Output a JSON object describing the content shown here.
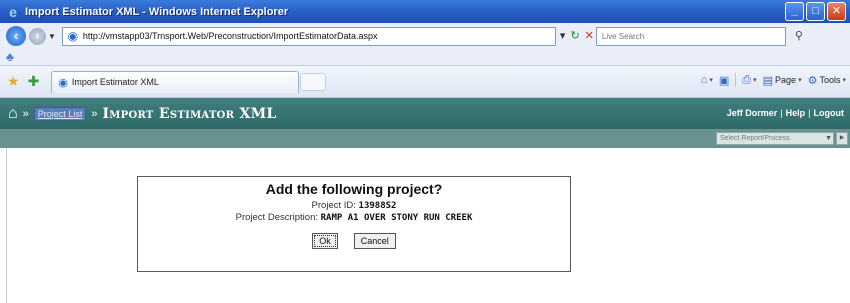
{
  "window": {
    "title": "Import Estimator XML - Windows Internet Explorer",
    "minimize": "_",
    "maximize": "□",
    "close": "✕"
  },
  "address": {
    "url": "http://vmstapp03/Trnsport.Web/Preconstruction/ImportEstimatorData.aspx",
    "search_placeholder": "Live Search"
  },
  "tab": {
    "label": "Import Estimator XML"
  },
  "commands": {
    "page": "Page",
    "tools": "Tools"
  },
  "app": {
    "breadcrumb_link": "Project List",
    "page_title": "Import Estimator XML",
    "user": "Jeff Dormer",
    "help": "Help",
    "logout": "Logout",
    "subselect_text": "Select Report/Process"
  },
  "dialog": {
    "heading": "Add the following project?",
    "project_id_label": "Project ID:",
    "project_id": "13988S2",
    "description_label": "Project Description:",
    "description": "RAMP A1 OVER STONY RUN CREEK",
    "ok_label": "Ok",
    "cancel_label": "Cancel"
  },
  "colors": {
    "titlebar": "#2a5fc7",
    "app_header": "#3f7f7d",
    "sub_bar": "#69918f"
  }
}
